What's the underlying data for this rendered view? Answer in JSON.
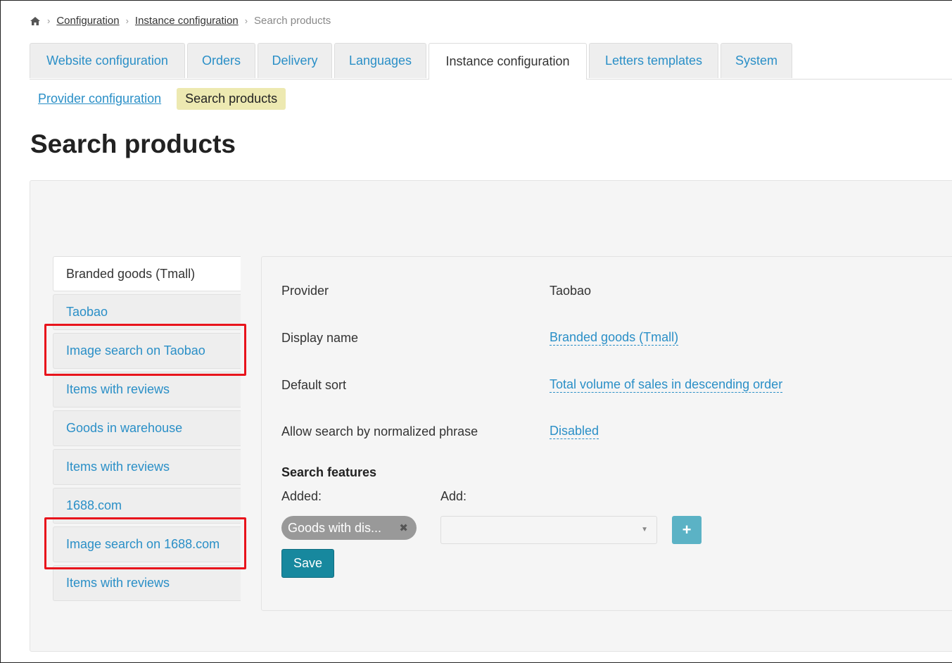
{
  "breadcrumb": {
    "home_icon": "home-icon",
    "items": [
      "Configuration",
      "Instance configuration"
    ],
    "current": "Search products"
  },
  "tabs": [
    {
      "label": "Website configuration"
    },
    {
      "label": "Orders"
    },
    {
      "label": "Delivery"
    },
    {
      "label": "Languages"
    },
    {
      "label": "Instance configuration",
      "active": true
    },
    {
      "label": "Letters templates"
    },
    {
      "label": "System"
    }
  ],
  "subnav": {
    "provider_link": "Provider configuration",
    "active_pill": "Search products"
  },
  "page_title": "Search products",
  "side_tabs": [
    {
      "label": "Branded goods (Tmall)",
      "active": true
    },
    {
      "label": "Taobao"
    },
    {
      "label": "Image search on Taobao",
      "highlighted": true
    },
    {
      "label": "Items with reviews"
    },
    {
      "label": "Goods in warehouse"
    },
    {
      "label": "Items with reviews"
    },
    {
      "label": "1688.com"
    },
    {
      "label": "Image search on 1688.com",
      "highlighted": true
    },
    {
      "label": "Items with reviews"
    }
  ],
  "details": {
    "provider_label": "Provider",
    "provider_value": "Taobao",
    "display_name_label": "Display name",
    "display_name_value": "Branded goods (Tmall)",
    "default_sort_label": "Default sort",
    "default_sort_value": "Total volume of sales in descending order",
    "normalized_label": "Allow search by normalized phrase",
    "normalized_value": "Disabled"
  },
  "features": {
    "title": "Search features",
    "added_label": "Added:",
    "add_label": "Add:",
    "chip": "Goods with dis...",
    "select_value": "",
    "plus_label": "+",
    "save_label": "Save"
  },
  "colors": {
    "link": "#2a8fc7",
    "highlight": "#e8141c",
    "save_button": "#17889e",
    "active_pill": "#ede9b1"
  }
}
